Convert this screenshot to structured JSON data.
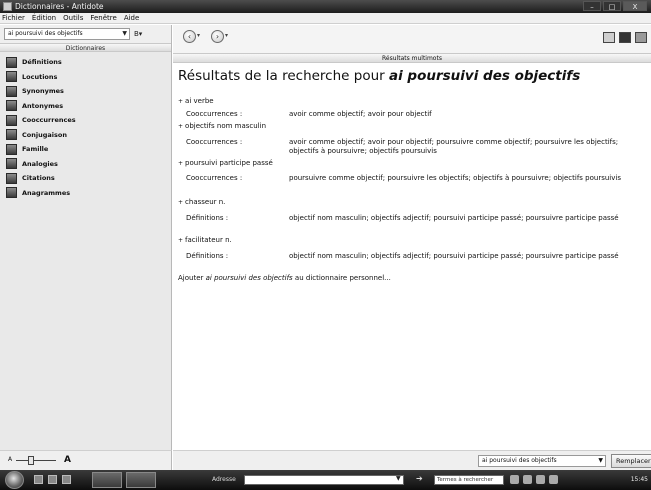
{
  "window": {
    "title": "Dictionnaires - Antidote",
    "controls": [
      "–",
      "□",
      "X"
    ]
  },
  "menu": [
    "Fichier",
    "Édition",
    "Outils",
    "Fenêtre",
    "Aide"
  ],
  "left_panel": {
    "search_value": "ai poursuivi des objectifs",
    "header": "Dictionnaires",
    "items": [
      "Définitions",
      "Locutions",
      "Synonymes",
      "Antonymes",
      "Cooccurrences",
      "Conjugaison",
      "Famille",
      "Analogies",
      "Citations",
      "Anagrammes"
    ]
  },
  "toolbar": {
    "back_icon": "back-arrow-icon",
    "forward_icon": "forward-arrow-icon"
  },
  "results_header": "Résultats multimots",
  "results": {
    "title_prefix": "Résultats de la recherche pour ",
    "query": "ai poursuivi des objectifs",
    "entries": [
      {
        "head": "ai verbe",
        "rows": [
          {
            "label": "Cooccurrences :",
            "value": "avoir comme objectif; avoir pour objectif"
          }
        ]
      },
      {
        "head": "objectifs nom masculin",
        "rows": [
          {
            "label": "Cooccurrences :",
            "value": "avoir comme objectif; avoir pour objectif; poursuivre comme objectif; poursuivre les objectifs; objectifs à poursuivre; objectifs poursuivis"
          }
        ]
      },
      {
        "head": "poursuivi participe passé",
        "rows": [
          {
            "label": "Cooccurrences :",
            "value": "poursuivre comme objectif; poursuivre les objectifs; objectifs à poursuivre; objectifs poursuivis"
          }
        ]
      },
      {
        "head": "chasseur n.",
        "rows": [
          {
            "label": "Définitions :",
            "value": "objectif nom masculin; objectifs adjectif; poursuivi participe passé; poursuivre participe passé"
          }
        ]
      },
      {
        "head": "facilitateur n.",
        "rows": [
          {
            "label": "Définitions :",
            "value": "objectif nom masculin; objectifs adjectif; poursuivi participe passé; poursuivre participe passé"
          }
        ]
      }
    ],
    "add_prefix": "Ajouter ",
    "add_query": "ai poursuivi des objectifs",
    "add_suffix": " au dictionnaire personnel..."
  },
  "bottom": {
    "zoom_small": "A",
    "zoom_big": "A",
    "replace_value": "ai poursuivi des objectifs",
    "replace_button": "Remplacer"
  },
  "taskbar": {
    "address_label": "Adresse",
    "search_placeholder": "Termes à rechercher",
    "clock": "15:45"
  }
}
